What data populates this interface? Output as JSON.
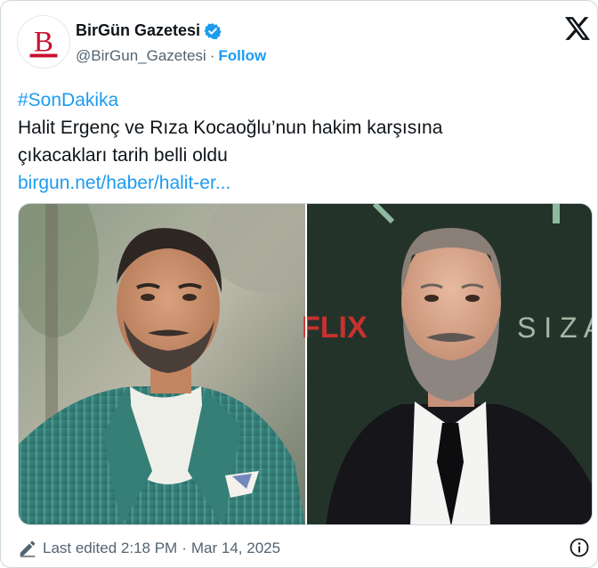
{
  "author": {
    "name": "BirGün Gazetesi",
    "handle": "@BirGun_Gazetesi",
    "separator": "·",
    "follow_label": "Follow",
    "avatar_letter": "B",
    "verified_icon": "verified-badge-icon"
  },
  "platform_icon": "x-logo-icon",
  "tweet": {
    "hashtag": "#SonDakika",
    "line1": "Halit Ergenç ve Rıza Kocaoğlu’nun hakim karşısına",
    "line2": "çıkacakları tarih belli oldu",
    "link": "birgun.net/haber/halit-er..."
  },
  "media": {
    "left_photo": "man-in-green-pinstripe-jacket-photo",
    "right_photo": "bearded-man-in-black-suit-photo",
    "backdrop_text": "FLIX",
    "backdrop_text2": "S I Z  A"
  },
  "footer": {
    "edit_icon": "pencil-edit-icon",
    "edited_label": "Last edited 2:18 PM",
    "separator": "·",
    "date": "Mar 14, 2025",
    "info_icon": "info-icon"
  },
  "colors": {
    "link_blue": "#1d9bf0",
    "text_primary": "#0f1419",
    "text_secondary": "#536471",
    "brand_red": "#c8102e",
    "border": "#cfd9de"
  }
}
